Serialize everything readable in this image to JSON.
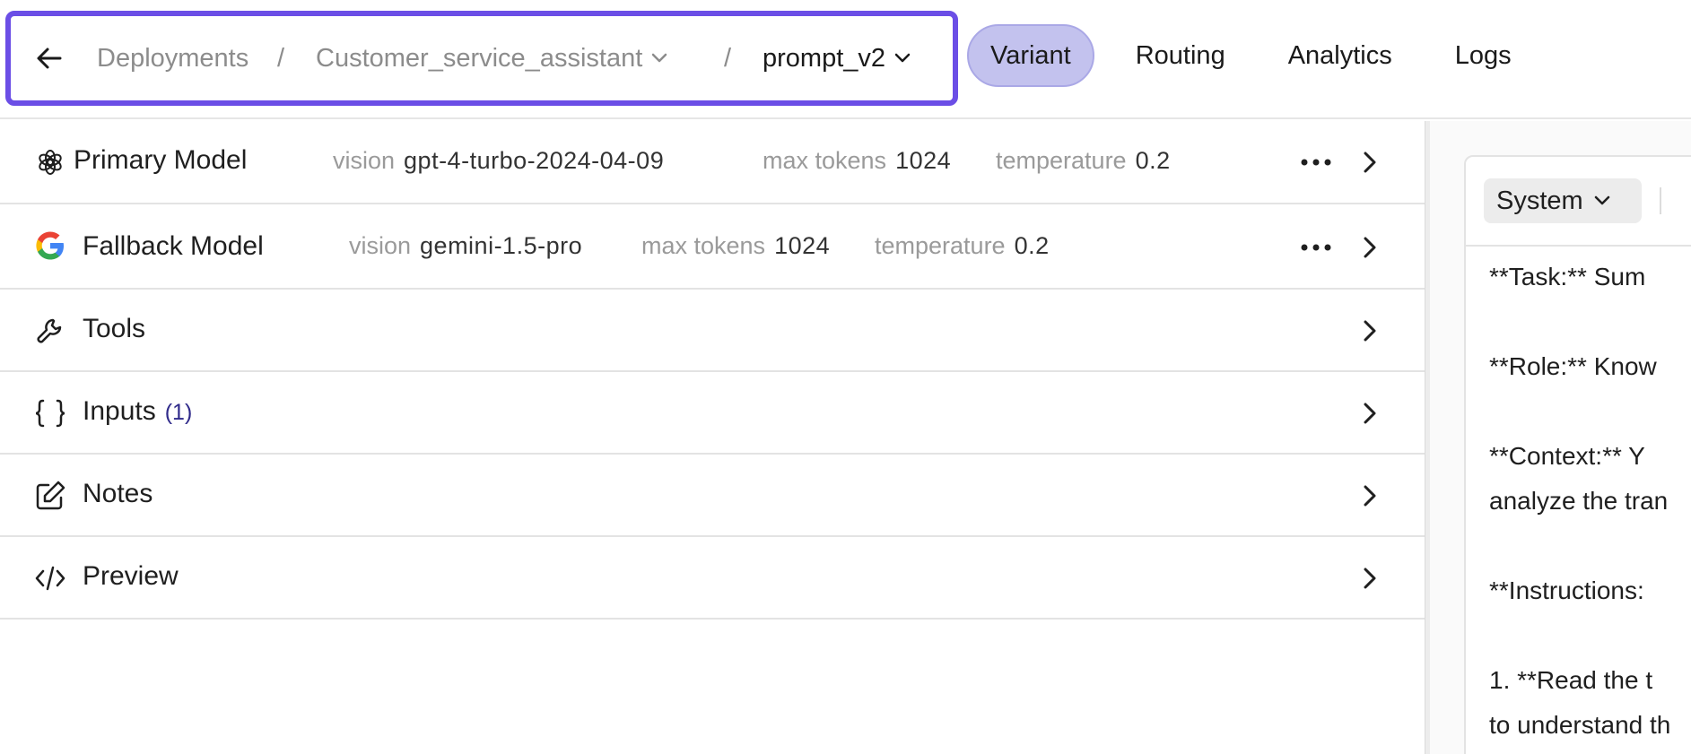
{
  "breadcrumb": {
    "items": [
      {
        "label": "Deployments"
      },
      {
        "label": "Customer_service_assistant"
      },
      {
        "label": "prompt_v2"
      }
    ],
    "separator": "/"
  },
  "tabs": [
    {
      "label": "Variant",
      "active": true
    },
    {
      "label": "Routing",
      "active": false
    },
    {
      "label": "Analytics",
      "active": false
    },
    {
      "label": "Logs",
      "active": false
    }
  ],
  "models": {
    "primary": {
      "title": "Primary Model",
      "icon": "openai-icon",
      "vision_key": "vision",
      "vision_value": "gpt-4-turbo-2024-04-09",
      "tokens_key": "max tokens",
      "tokens_value": "1024",
      "temp_key": "temperature",
      "temp_value": "0.2"
    },
    "fallback": {
      "title": "Fallback Model",
      "icon": "google-icon",
      "vision_key": "vision",
      "vision_value": "gemini-1.5-pro",
      "tokens_key": "max tokens",
      "tokens_value": "1024",
      "temp_key": "temperature",
      "temp_value": "0.2"
    }
  },
  "sections": {
    "tools": {
      "title": "Tools",
      "icon": "wrench-icon"
    },
    "inputs": {
      "title": "Inputs",
      "count": "(1)",
      "icon": "braces-icon"
    },
    "notes": {
      "title": "Notes",
      "icon": "edit-icon"
    },
    "preview": {
      "title": "Preview",
      "icon": "code-icon"
    }
  },
  "prompt_editor": {
    "role": "System",
    "lines": [
      "**Task:** Sum",
      "**Role:** Know",
      "**Context:** Y",
      "analyze the tran",
      "**Instructions:",
      "1. **Read the t",
      "to understand th"
    ]
  },
  "colors": {
    "accent": "#6b4ee6",
    "active_tab_bg": "#c3c2ee",
    "count_color": "#2f2a8a"
  }
}
